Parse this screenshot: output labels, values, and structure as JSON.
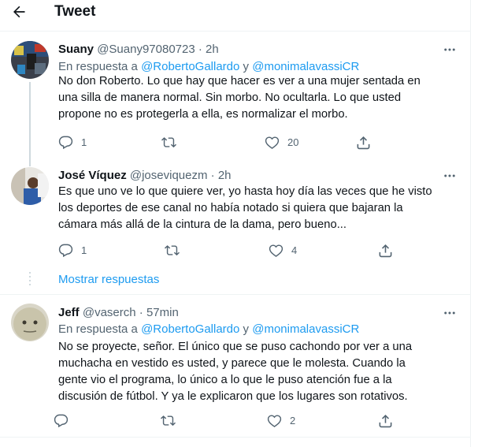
{
  "header": {
    "back_icon": "arrow-left-icon",
    "title": "Tweet"
  },
  "tweets": [
    {
      "name": "Suany",
      "handle": "@Suany97080723",
      "dot": "·",
      "time": "2h",
      "reply_prefix": "En respuesta a",
      "mentions": [
        "@RobertoGallardo",
        "@monimalavassiCR"
      ],
      "reply_joiner": "y",
      "text": "No don Roberto. Lo que hay que hacer es ver a una mujer sentada en una silla de manera normal. Sin morbo. No ocultarla. Lo que usted propone no es protegerla a ella, es normalizar el morbo.",
      "replies": "1",
      "retweets": "",
      "likes": "20"
    },
    {
      "name": "José Víquez",
      "handle": "@joseviquezm",
      "dot": "·",
      "time": "2h",
      "text": "Es que uno ve lo que quiere ver, yo hasta hoy día las veces que he visto los deportes de ese canal no había notado si quiera que bajaran la cámara más allá de la cintura de la dama, pero bueno...",
      "replies": "1",
      "retweets": "",
      "likes": "4"
    },
    {
      "name": "Jeff",
      "handle": "@vaserch",
      "dot": "·",
      "time": "57min",
      "reply_prefix": "En respuesta a",
      "mentions": [
        "@RobertoGallardo",
        "@monimalavassiCR"
      ],
      "reply_joiner": "y",
      "text": "No se proyecte, señor. El único que se puso cachondo por ver a una muchacha en vestido es usted, y parece que le molesta. Cuando la gente vio el programa, lo único a lo que le puso atención fue a la discusión de fútbol. Y ya le explicaron que los lugares son rotativos.",
      "replies": "",
      "retweets": "",
      "likes": "2"
    }
  ],
  "show_more_replies": "Mostrar respuestas",
  "icons": [
    "reply-icon",
    "retweet-icon",
    "like-icon",
    "share-icon",
    "more-icon"
  ],
  "colors": {
    "accent": "#1d9bf0",
    "text": "#0f1419",
    "secondary": "#536471",
    "divider": "#eff3f4"
  }
}
